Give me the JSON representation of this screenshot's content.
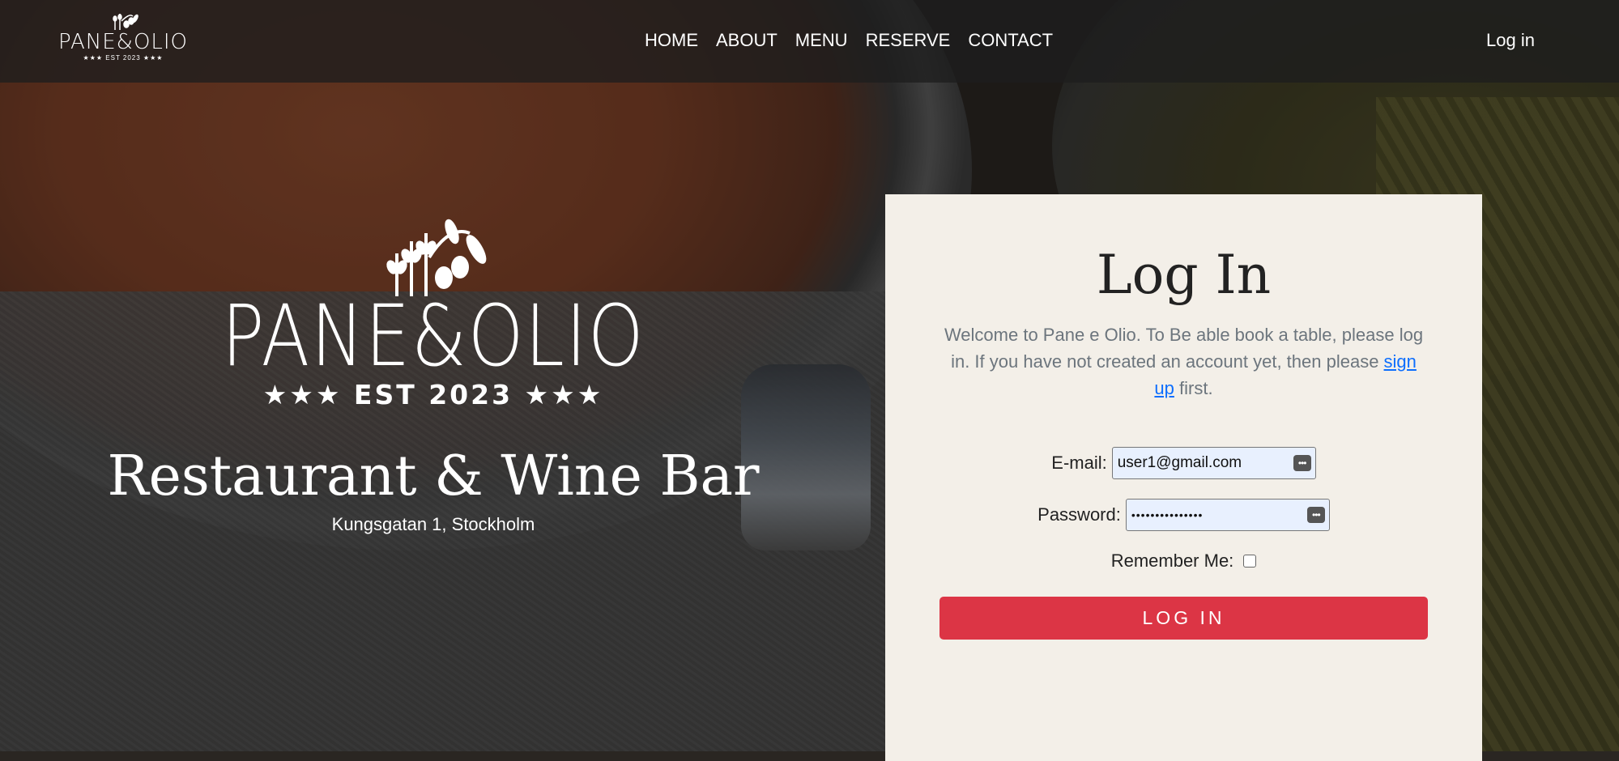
{
  "brand": {
    "name": "PANE&OLIO",
    "est": "★★★ EST 2023 ★★★"
  },
  "nav": {
    "links": [
      "HOME",
      "ABOUT",
      "MENU",
      "RESERVE",
      "CONTACT"
    ],
    "login": "Log in"
  },
  "hero": {
    "logo_name": "PANE&OLIO",
    "logo_est": "★★★ EST 2023 ★★★",
    "tagline": "Restaurant & Wine Bar",
    "address": "Kungsgatan 1, Stockholm"
  },
  "login_card": {
    "title": "Log In",
    "intro_before": "Welcome to Pane e Olio. To Be able book a table, please log in. If you have not created an account yet, then please ",
    "signup_link": "sign up",
    "intro_after": " first.",
    "email_label": "E-mail:",
    "email_value": "user1@gmail.com",
    "password_label": "Password:",
    "password_value": "•••••••••••••••",
    "remember_label": "Remember Me:",
    "remember_checked": false,
    "submit_label": "LOG IN"
  },
  "colors": {
    "accent": "#dc3545",
    "card_bg": "#f3efe8",
    "link": "#0d6efd",
    "autofill_bg": "#e8f0fe"
  },
  "icons": [
    "wheat-olive-logo-icon",
    "autofill-key-icon"
  ]
}
